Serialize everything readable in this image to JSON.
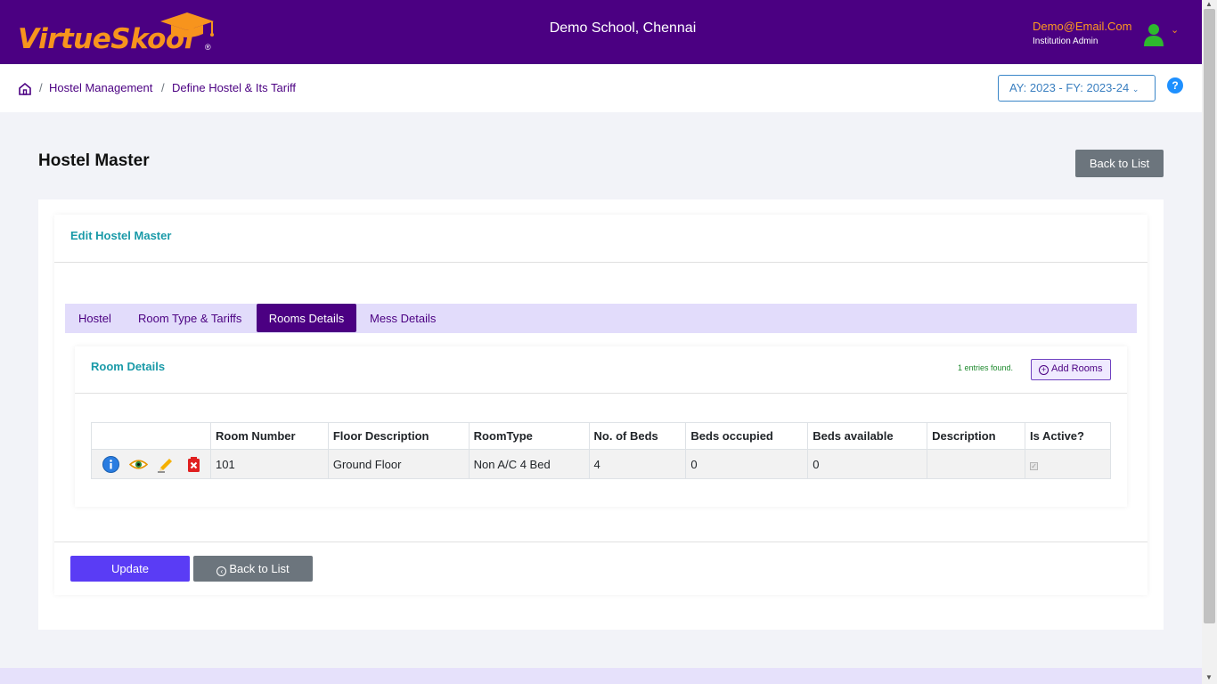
{
  "header": {
    "logo_text_1": "Virtue",
    "logo_text_2": "Skool",
    "logo_reg": "®",
    "school_name": "Demo School, Chennai",
    "user_email": "Demo@Email.Com",
    "user_role": "Institution Admin",
    "icons": [
      "graduation-cap-icon",
      "user-avatar-icon",
      "chevron-down-icon"
    ],
    "colors": {
      "bar": "#4b0082",
      "brand_orange": "#f7941d"
    }
  },
  "breadcrumb": {
    "items": [
      "Hostel Management",
      "Define Hostel & Its Tariff"
    ],
    "separator": "/",
    "icon": "home-icon"
  },
  "academic_year": "AY: 2023 - FY: 2023-24",
  "help_label": "?",
  "page": {
    "title": "Hostel Master",
    "back_to_list": "Back to List"
  },
  "form": {
    "title": "Edit Hostel Master",
    "tabs": [
      {
        "label": "Hostel",
        "active": false
      },
      {
        "label": "Room Type & Tariffs",
        "active": false
      },
      {
        "label": "Rooms Details",
        "active": true
      },
      {
        "label": "Mess Details",
        "active": false
      }
    ]
  },
  "room_details": {
    "title": "Room Details",
    "entries_found": "1 entries found.",
    "add_rooms": "Add Rooms",
    "columns": [
      "",
      "Room Number",
      "Floor Description",
      "RoomType",
      "No. of Beds",
      "Beds occupied",
      "Beds available",
      "Description",
      "Is Active?"
    ],
    "rows": [
      {
        "actions": [
          "info-icon",
          "view-eye-icon",
          "edit-pencil-icon",
          "delete-icon"
        ],
        "room_number": "101",
        "floor_description": "Ground Floor",
        "room_type": "Non A/C 4 Bed",
        "no_of_beds": "4",
        "beds_occupied": "0",
        "beds_available": "0",
        "description": "",
        "is_active": true
      }
    ]
  },
  "footer_buttons": {
    "update": "Update",
    "back_to_list": "Back to List"
  }
}
